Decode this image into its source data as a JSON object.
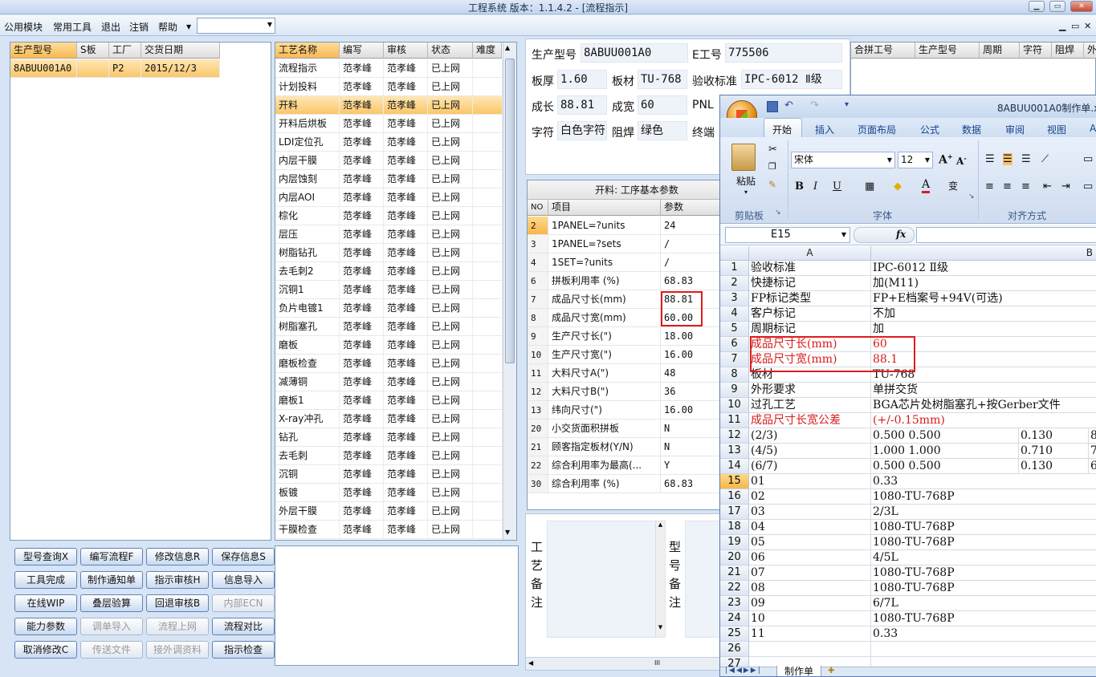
{
  "window": {
    "title": "工程系统   版本：1.1.4.2 - [流程指示]"
  },
  "menu": {
    "items": [
      "公用模块",
      "常用工具",
      "退出",
      "注销",
      "帮助"
    ],
    "combo_value": ""
  },
  "left_grid": {
    "headers": [
      "生产型号",
      "S板",
      "工厂",
      "交货日期"
    ],
    "rows": [
      {
        "model": "8ABUU001A0",
        "s": "",
        "factory": "P2",
        "date": "2015/12/3"
      }
    ]
  },
  "process_grid": {
    "headers": [
      "工艺名称",
      "编写",
      "审核",
      "状态",
      "难度"
    ],
    "rows": [
      [
        "流程指示",
        "范孝峰",
        "范孝峰",
        "已上网"
      ],
      [
        "计划投料",
        "范孝峰",
        "范孝峰",
        "已上网"
      ],
      [
        "开料",
        "范孝峰",
        "范孝峰",
        "已上网"
      ],
      [
        "开料后烘板",
        "范孝峰",
        "范孝峰",
        "已上网"
      ],
      [
        "LDI定位孔",
        "范孝峰",
        "范孝峰",
        "已上网"
      ],
      [
        "内层干膜",
        "范孝峰",
        "范孝峰",
        "已上网"
      ],
      [
        "内层蚀刻",
        "范孝峰",
        "范孝峰",
        "已上网"
      ],
      [
        "内层AOI",
        "范孝峰",
        "范孝峰",
        "已上网"
      ],
      [
        "棕化",
        "范孝峰",
        "范孝峰",
        "已上网"
      ],
      [
        "层压",
        "范孝峰",
        "范孝峰",
        "已上网"
      ],
      [
        "树脂钻孔",
        "范孝峰",
        "范孝峰",
        "已上网"
      ],
      [
        "去毛刺2",
        "范孝峰",
        "范孝峰",
        "已上网"
      ],
      [
        "沉铜1",
        "范孝峰",
        "范孝峰",
        "已上网"
      ],
      [
        "负片电镀1",
        "范孝峰",
        "范孝峰",
        "已上网"
      ],
      [
        "树脂塞孔",
        "范孝峰",
        "范孝峰",
        "已上网"
      ],
      [
        "磨板",
        "范孝峰",
        "范孝峰",
        "已上网"
      ],
      [
        "磨板检查",
        "范孝峰",
        "范孝峰",
        "已上网"
      ],
      [
        "减薄铜",
        "范孝峰",
        "范孝峰",
        "已上网"
      ],
      [
        "磨板1",
        "范孝峰",
        "范孝峰",
        "已上网"
      ],
      [
        "X-ray冲孔",
        "范孝峰",
        "范孝峰",
        "已上网"
      ],
      [
        "钻孔",
        "范孝峰",
        "范孝峰",
        "已上网"
      ],
      [
        "去毛刺",
        "范孝峰",
        "范孝峰",
        "已上网"
      ],
      [
        "沉铜",
        "范孝峰",
        "范孝峰",
        "已上网"
      ],
      [
        "板镀",
        "范孝峰",
        "范孝峰",
        "已上网"
      ],
      [
        "外层干膜",
        "范孝峰",
        "范孝峰",
        "已上网"
      ],
      [
        "干膜检查",
        "范孝峰",
        "范孝峰",
        "已上网"
      ]
    ]
  },
  "buttons": [
    [
      "型号查询X",
      "编写流程F",
      "修改信息R",
      "保存信息S"
    ],
    [
      "工具完成",
      "制作通知单",
      "指示审核H",
      "信息导入"
    ],
    [
      "在线WIP",
      "叠层验算",
      "回退审核B",
      "内部ECN"
    ],
    [
      "能力参数",
      "调单导入",
      "流程上网",
      "流程对比"
    ],
    [
      "取消修改C",
      "传送文件",
      "接外调资料",
      "指示检查"
    ]
  ],
  "info": {
    "model_label": "生产型号",
    "model_value": "8ABUU001A0",
    "eno_label": "E工号",
    "eno_value": "775506",
    "thick_label": "板厚",
    "thick_value": "1.60",
    "material_label": "板材",
    "material_value": "TU-768",
    "std_label": "验收标准",
    "std_value": "IPC-6012 Ⅱ级",
    "len_label": "成长",
    "len_value": "88.81",
    "wid_label": "成宽",
    "wid_value": "60",
    "pnl_label": "PNL",
    "char_label": "字符",
    "char_value": "白色字符",
    "mask_label": "阻焊",
    "mask_value": "绿色",
    "end_label": "终端"
  },
  "combine_grid": {
    "headers": [
      "合拼工号",
      "生产型号",
      "周期",
      "字符",
      "阻焊",
      "外层"
    ]
  },
  "params": {
    "title": "开料: 工序基本参数",
    "headers": [
      "NO",
      "项目",
      "参数"
    ],
    "rows": [
      [
        "2",
        "1PANEL=?units",
        "24"
      ],
      [
        "3",
        "1PANEL=?sets",
        "/"
      ],
      [
        "4",
        "1SET=?units",
        "/"
      ],
      [
        "6",
        "拼板利用率 (%)",
        "68.83"
      ],
      [
        "7",
        "成品尺寸长(mm)",
        "88.81"
      ],
      [
        "8",
        "成品尺寸宽(mm)",
        "60.00"
      ],
      [
        "9",
        "生产尺寸长(\")",
        "18.00"
      ],
      [
        "10",
        "生产尺寸宽(\")",
        "16.00"
      ],
      [
        "11",
        "大料尺寸A(\")",
        "48"
      ],
      [
        "12",
        "大料尺寸B(\")",
        "36"
      ],
      [
        "13",
        "纬向尺寸(\")",
        "16.00"
      ],
      [
        "20",
        "小交货面积拼板",
        "N"
      ],
      [
        "21",
        "顾客指定板材(Y/N)",
        "N"
      ],
      [
        "22",
        "综合利用率为最高(...",
        "Y"
      ],
      [
        "30",
        "综合利用率 (%)",
        "68.83"
      ]
    ]
  },
  "notes": {
    "process_label": [
      "工",
      "艺",
      "备",
      "注"
    ],
    "model_label": [
      "型",
      "号",
      "备",
      "注"
    ],
    "scroll_mark": "III"
  },
  "excel": {
    "title": "8ABUU001A0制作单.x",
    "tabs": [
      "开始",
      "插入",
      "页面布局",
      "公式",
      "数据",
      "审阅",
      "视图",
      "A"
    ],
    "font_name": "宋体",
    "font_size": "12",
    "paste_label": "粘贴",
    "groups": [
      "剪贴板",
      "字体",
      "对齐方式"
    ],
    "name_box": "E15",
    "fx": "fx",
    "col_headers": [
      "A",
      "B"
    ],
    "sheet_tab": "制作单",
    "rows": [
      {
        "n": "1",
        "a": "验收标准",
        "b": "IPC-6012 Ⅱ级"
      },
      {
        "n": "2",
        "a": "快捷标记",
        "b": "加(M11)"
      },
      {
        "n": "3",
        "a": "FP标记类型",
        "b": "FP+E档案号+94V(可选)"
      },
      {
        "n": "4",
        "a": "客户标记",
        "b": "不加"
      },
      {
        "n": "5",
        "a": "周期标记",
        "b": "加"
      },
      {
        "n": "6",
        "a": "成品尺寸长(mm)",
        "b": "60",
        "red": true
      },
      {
        "n": "7",
        "a": "成品尺寸宽(mm)",
        "b": "88.1",
        "red": true
      },
      {
        "n": "8",
        "a": "板材",
        "b": "TU-768"
      },
      {
        "n": "9",
        "a": "外形要求",
        "b": "单拼交货"
      },
      {
        "n": "10",
        "a": "过孔工艺",
        "b": "BGA芯片处树脂塞孔+按Gerber文件"
      },
      {
        "n": "11",
        "a": "成品尺寸长宽公差",
        "b": "(+/-0.15mm)",
        "red": true
      },
      {
        "n": "12",
        "a": "(2/3)",
        "b": "0.500  0.500",
        "c": "0.130",
        "d": "8"
      },
      {
        "n": "13",
        "a": "(4/5)",
        "b": "1.000  1.000",
        "c": "0.710",
        "d": "7"
      },
      {
        "n": "14",
        "a": "(6/7)",
        "b": "0.500  0.500",
        "c": "0.130",
        "d": "6"
      },
      {
        "n": "15",
        "a": "01",
        "b": "0.33",
        "sel": true
      },
      {
        "n": "16",
        "a": "02",
        "b": "1080-TU-768P"
      },
      {
        "n": "17",
        "a": "03",
        "b": "2/3L"
      },
      {
        "n": "18",
        "a": "04",
        "b": "1080-TU-768P"
      },
      {
        "n": "19",
        "a": "05",
        "b": "1080-TU-768P"
      },
      {
        "n": "20",
        "a": "06",
        "b": "4/5L"
      },
      {
        "n": "21",
        "a": "07",
        "b": "1080-TU-768P"
      },
      {
        "n": "22",
        "a": "08",
        "b": "1080-TU-768P"
      },
      {
        "n": "23",
        "a": "09",
        "b": "6/7L"
      },
      {
        "n": "24",
        "a": "10",
        "b": "1080-TU-768P"
      },
      {
        "n": "25",
        "a": "11",
        "b": "0.33"
      },
      {
        "n": "26",
        "a": "",
        "b": ""
      },
      {
        "n": "27",
        "a": "",
        "b": ""
      }
    ]
  },
  "colors": {
    "selection": "#fbc66a",
    "highlight_red": "#e01b1b",
    "panel_bg": "#d6e4f5"
  }
}
